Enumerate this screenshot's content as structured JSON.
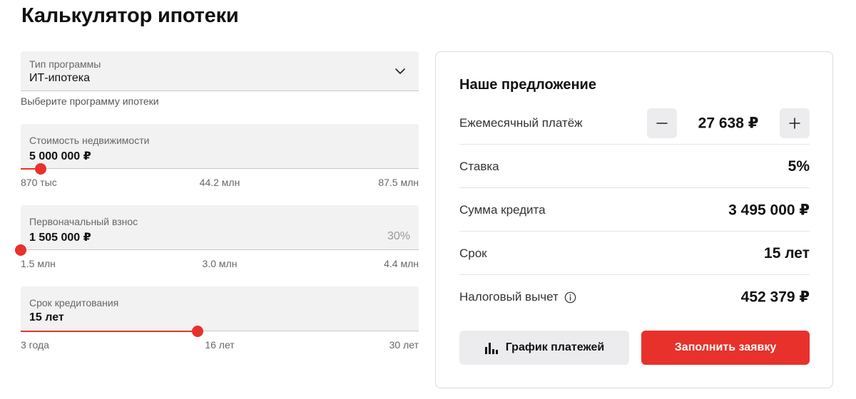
{
  "page": {
    "title": "Калькулятор ипотеки"
  },
  "program": {
    "label": "Тип программы",
    "value": "ИТ-ипотека",
    "helper": "Выберите программу ипотеки"
  },
  "property_price": {
    "label": "Стоимость недвижимости",
    "value": "5 000 000 ₽",
    "scale_min": "870 тыс",
    "scale_mid": "44.2 млн",
    "scale_max": "87.5 млн",
    "slider_fraction": 0.05
  },
  "down_payment": {
    "label": "Первоначальный взнос",
    "value": "1 505 000 ₽",
    "percent": "30%",
    "scale_min": "1.5 млн",
    "scale_mid": "3.0 млн",
    "scale_max": "4.4 млн",
    "slider_fraction": 0.0
  },
  "loan_term": {
    "label": "Срок кредитования",
    "value": "15 лет",
    "scale_min": "3 года",
    "scale_mid": "16 лет",
    "scale_max": "30 лет",
    "slider_fraction": 0.445
  },
  "offer": {
    "title": "Наше предложение",
    "monthly_payment_label": "Ежемесячный платёж",
    "monthly_payment_value": "27 638 ₽",
    "rate_label": "Ставка",
    "rate_value": "5%",
    "loan_amount_label": "Сумма кредита",
    "loan_amount_value": "3 495 000 ₽",
    "term_label": "Срок",
    "term_value": "15 лет",
    "tax_deduction_label": "Налоговый вычет",
    "tax_deduction_value": "452 379 ₽",
    "schedule_button": "График платежей",
    "apply_button": "Заполнить заявку"
  },
  "icons": {
    "select": "chevron-down-icon",
    "decrease": "minus-icon",
    "increase": "plus-icon",
    "info": "info-icon",
    "schedule": "bar-chart-icon"
  },
  "colors": {
    "accent": "#e8312b",
    "field_bg": "#f2f2f3",
    "button_gray": "#ececee"
  }
}
